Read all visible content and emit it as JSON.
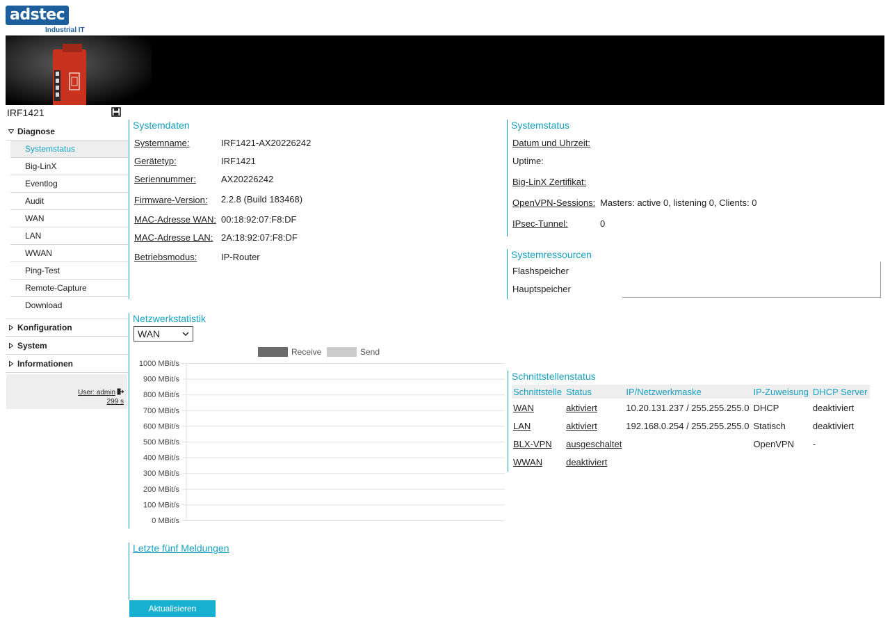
{
  "header": {
    "logo_text": "adstec",
    "logo_sub": "Industrial IT"
  },
  "device": {
    "name": "IRF1421"
  },
  "nav": {
    "groups": [
      {
        "label": "Diagnose",
        "expanded": true,
        "items": [
          "Systemstatus",
          "Big-LinX",
          "Eventlog",
          "Audit",
          "WAN",
          "LAN",
          "WWAN",
          "Ping-Test",
          "Remote-Capture",
          "Download"
        ],
        "active": "Systemstatus"
      },
      {
        "label": "Konfiguration",
        "expanded": false
      },
      {
        "label": "System",
        "expanded": false
      },
      {
        "label": "Informationen",
        "expanded": false
      }
    ],
    "user": "User: admin",
    "timer": "299 s"
  },
  "systemdaten": {
    "title": "Systemdaten",
    "rows": [
      {
        "k": "Systemname:",
        "v": "IRF1421-AX20226242"
      },
      {
        "k": "Gerätetyp:",
        "v": "IRF1421"
      },
      {
        "k": "Seriennummer:",
        "v": "AX20226242"
      },
      {
        "k": "Firmware-Version:",
        "v": "2.2.8 (Build 183468)"
      },
      {
        "k": "MAC-Adresse WAN:",
        "v": "00:18:92:07:F8:DF"
      },
      {
        "k": "MAC-Adresse LAN:",
        "v": "2A:18:92:07:F8:DF"
      },
      {
        "k": "Betriebsmodus:",
        "v": "IP-Router"
      }
    ]
  },
  "systemstatus": {
    "title": "Systemstatus",
    "rows": [
      {
        "k": "Datum und Uhrzeit:",
        "v": ""
      },
      {
        "k": "Uptime:",
        "v": ""
      },
      {
        "k": "Big-LinX Zertifikat:",
        "v": ""
      },
      {
        "k": "OpenVPN-Sessions:",
        "v": "Masters: active 0, listening 0, Clients: 0"
      },
      {
        "k": "IPsec-Tunnel:",
        "v": "0"
      }
    ]
  },
  "systemressourcen": {
    "title": "Systemressourcen",
    "rows": [
      "Flashspeicher",
      "Hauptspeicher"
    ]
  },
  "netzwerkstatistik": {
    "title": "Netzwerkstatistik",
    "selected_interface": "WAN"
  },
  "chart_data": {
    "type": "area",
    "title": "",
    "xlabel": "",
    "ylabel": "",
    "legend": "top",
    "grid": true,
    "ylim": [
      0,
      1000
    ],
    "y_unit": "MBit/s",
    "yticks": [
      "1000 MBit/s",
      "900 MBit/s",
      "800 MBit/s",
      "700 MBit/s",
      "600 MBit/s",
      "500 MBit/s",
      "400 MBit/s",
      "300 MBit/s",
      "200 MBit/s",
      "100 MBit/s",
      "0 MBit/s"
    ],
    "series": [
      {
        "name": "Receive",
        "color": "#6b6b6b",
        "values": []
      },
      {
        "name": "Send",
        "color": "#cccccc",
        "values": []
      }
    ]
  },
  "schnittstellenstatus": {
    "title": "Schnittstellenstatus",
    "headers": [
      "Schnittstelle",
      "Status",
      "IP/Netzwerkmaske",
      "IP-Zuweisung",
      "DHCP Server"
    ],
    "rows": [
      [
        "WAN",
        "aktiviert",
        "10.20.131.237 / 255.255.255.0",
        "DHCP",
        "deaktiviert"
      ],
      [
        "LAN",
        "aktiviert",
        "192.168.0.254 / 255.255.255.0",
        "Statisch",
        "deaktiviert"
      ],
      [
        "BLX-VPN",
        "ausgeschaltet",
        "",
        "OpenVPN",
        "-"
      ],
      [
        "WWAN",
        "deaktiviert",
        "",
        "",
        ""
      ]
    ]
  },
  "meldungen": {
    "title": "Letzte fünf Meldungen"
  },
  "refresh_label": "Aktualisieren",
  "colors": {
    "accent": "#18a0c0",
    "brand": "#1d5f9c"
  }
}
